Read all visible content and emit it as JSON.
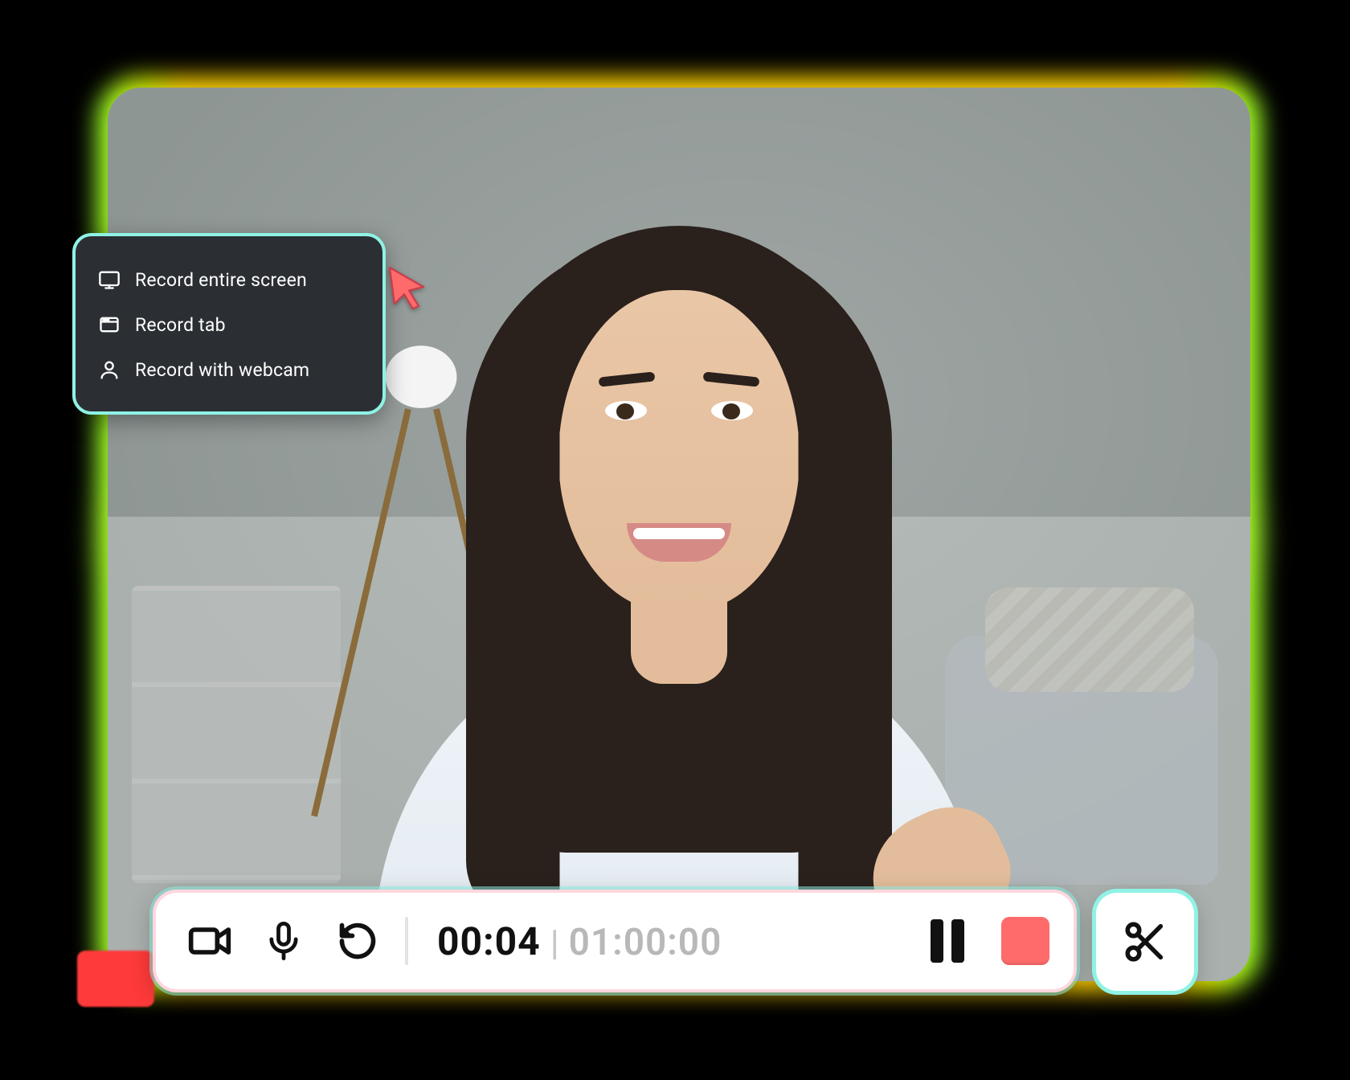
{
  "menu": {
    "items": [
      {
        "icon": "monitor-icon",
        "label": "Record entire screen"
      },
      {
        "icon": "tab-icon",
        "label": "Record tab"
      },
      {
        "icon": "person-icon",
        "label": "Record with webcam"
      }
    ]
  },
  "toolbar": {
    "elapsed": "00:04",
    "total": "01:00:00",
    "separator": "|"
  },
  "colors": {
    "accent_teal": "#8ff2e4",
    "stop_red": "#ff6b6b",
    "cursor_red": "#ff6b6b",
    "glow_yellow": "#ffd100"
  },
  "icons": {
    "camera": "camera-icon",
    "mic": "microphone-icon",
    "restart": "restart-icon",
    "pause": "pause-icon",
    "stop": "stop-icon",
    "trim": "scissors-icon",
    "cursor": "cursor-pointer-icon"
  }
}
